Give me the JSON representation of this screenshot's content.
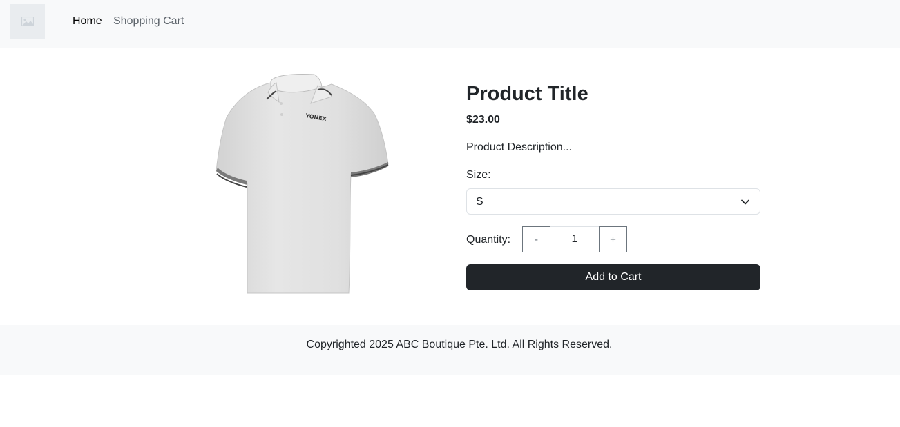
{
  "navbar": {
    "logo_icon": "image-placeholder-icon",
    "links": [
      {
        "label": "Home",
        "active": true
      },
      {
        "label": "Shopping Cart",
        "active": false
      }
    ]
  },
  "product": {
    "image_icon": "polo-shirt-image",
    "brand_mark": "YONEX",
    "title": "Product Title",
    "price": "$23.00",
    "description": "Product Description...",
    "size_label": "Size:",
    "size_selected": "S",
    "quantity_label": "Quantity:",
    "quantity_minus": "-",
    "quantity_value": "1",
    "quantity_plus": "+",
    "add_to_cart_label": "Add to Cart"
  },
  "footer": {
    "text": "Copyrighted 2025 ABC Boutique Pte. Ltd. All Rights Reserved."
  },
  "colors": {
    "navbar_bg": "#f8f9fa",
    "primary_dark": "#212529",
    "muted": "#6c757d"
  }
}
